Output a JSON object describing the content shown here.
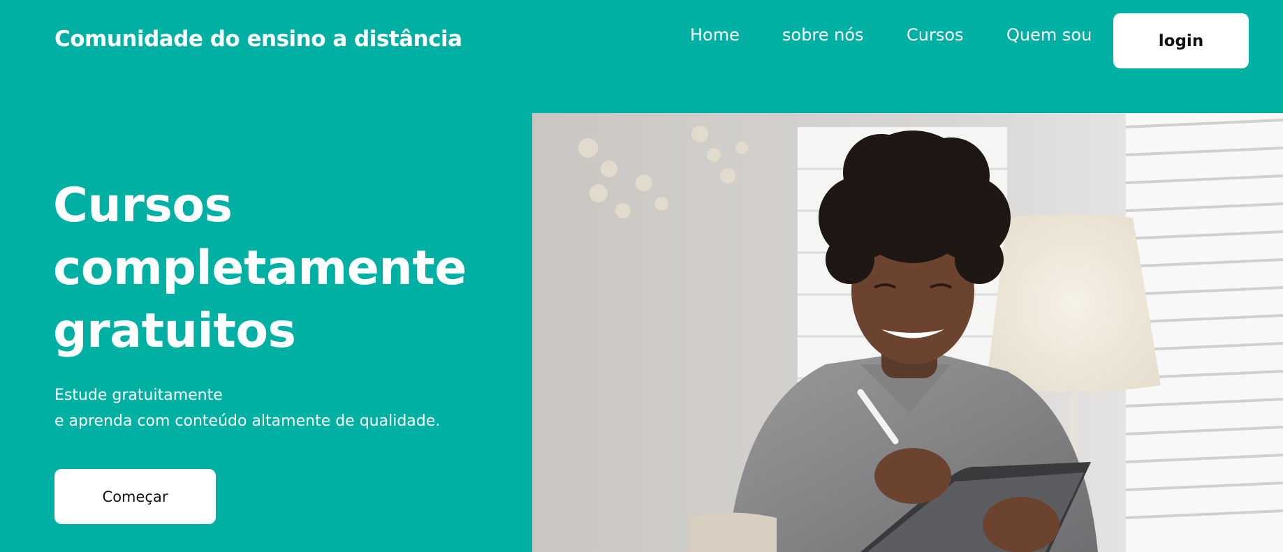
{
  "header": {
    "brand": "Comunidade do ensino a distância",
    "nav": {
      "home": "Home",
      "sobre": "sobre nós",
      "cursos": "Cursos",
      "quem": "Quem sou"
    },
    "login_label": "login"
  },
  "hero": {
    "title_lines": [
      "Cursos",
      "completamente",
      "gratuitos"
    ],
    "subtitle_lines": [
      "Estude gratuitamente",
      "e aprenda com conteúdo altamente de qualidade."
    ],
    "cta_label": "Começar"
  },
  "colors": {
    "background": "#00B1A3",
    "button_bg": "#FFFFFF",
    "button_text": "#111111"
  }
}
